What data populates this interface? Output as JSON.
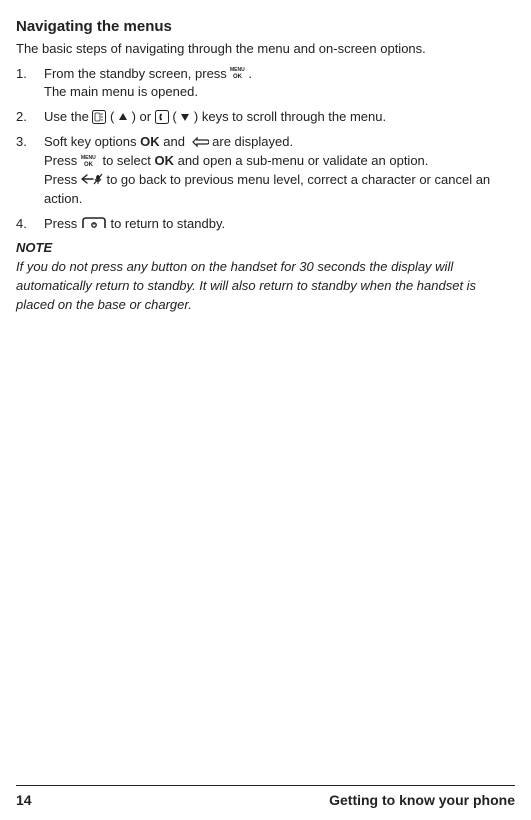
{
  "heading": "Navigating the menus",
  "intro": "The basic steps of navigating through the menu and on-screen options.",
  "steps": {
    "s1a": "From the standby screen, press ",
    "s1b": ".",
    "s1c": "The main menu is opened.",
    "s2a": "Use the ",
    "s2b": " ( ",
    "s2bt": " ) or  ",
    "s2c": "  ( ",
    "s2ct": " ) keys to scroll through the menu.",
    "s3a": "Soft key options ",
    "s3ok": "OK",
    "s3b": " and ",
    "s3c": " are displayed.",
    "s3d": "Press ",
    "s3e": " to select ",
    "s3f": " and open a sub-menu or validate an option.",
    "s3g": "Press ",
    "s3h": " to go back to previous menu level, correct a character or cancel an action.",
    "s4a": "Press ",
    "s4b": " to return to standby."
  },
  "note_title": "NOTE",
  "note_body": "If you do not press any button on the handset for 30 seconds the display will automatically return to standby. It will also return to standby when the handset is placed on the base or charger.",
  "footer": {
    "page": "14",
    "section": "Getting to know your phone"
  }
}
